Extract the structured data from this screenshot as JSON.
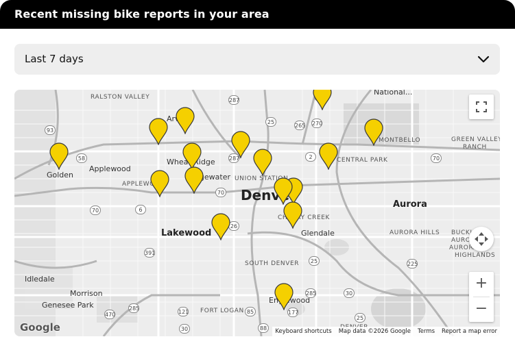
{
  "header": {
    "title": "Recent missing bike reports in your area"
  },
  "filter": {
    "selected": "Last 7 days"
  },
  "map": {
    "places": {
      "denver": "Denver",
      "aurora": "Aurora",
      "lakewood": "Lakewood",
      "golden": "Golden",
      "applewood": "Applewood",
      "wheat_ridge": "Wheat Ridge",
      "edgewater": "Edgewater",
      "glendale": "Glendale",
      "englewood": "Englewood",
      "morrison": "Morrison",
      "idledale": "Idledale",
      "genesee_park": "Genesee Park",
      "ralston_valley": "RALSTON VALLEY",
      "applewood_caps": "APPLEWOOD",
      "union_station": "UNION STATION",
      "cherry_creek": "CHERRY CREEK",
      "south_denver": "SOUTH DENVER",
      "fort_logan": "FORT LOGAN",
      "montbello": "MONTBELLO",
      "central_park": "CENTRAL PARK",
      "green_valley_ranch_1": "GREEN VALLEY",
      "green_valley_ranch_2": "RANCH",
      "aurora_hills": "AURORA HILLS",
      "buckley_1": "BUCKLEY",
      "buckley_2": "AURORA",
      "aurora_highlands_1": "AURORA",
      "aurora_highlands_2": "HIGHLANDS",
      "national": "National...",
      "denver_tech": "DENVER",
      "arvada_partial": "Arv"
    },
    "shields": [
      "287",
      "25",
      "270",
      "265",
      "6",
      "93",
      "58",
      "2",
      "287",
      "70",
      "70",
      "6",
      "70",
      "26",
      "25",
      "225",
      "391",
      "30",
      "285",
      "285",
      "470",
      "121",
      "85",
      "177",
      "88",
      "30",
      "25"
    ],
    "controls": {
      "zoom_in": "+",
      "zoom_out": "−"
    },
    "logo": "Google",
    "attribution": {
      "shortcuts": "Keyboard shortcuts",
      "map_data": "Map data ©2026 Google",
      "terms": "Terms",
      "report": "Report a map error"
    },
    "marker_color": "#f5d000",
    "marker_count": 18
  }
}
